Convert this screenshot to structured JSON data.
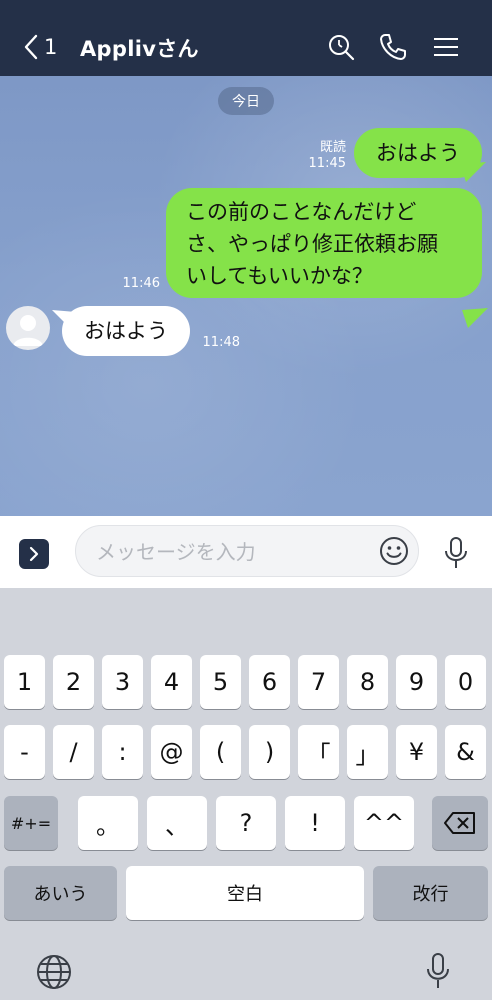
{
  "header": {
    "back_count": "1",
    "title": "Applivさん",
    "icons": [
      "chevron-left-icon",
      "search-icon",
      "phone-icon",
      "menu-icon"
    ]
  },
  "chat": {
    "date_label": "今日",
    "messages": [
      {
        "direction": "out",
        "text": "おはよう",
        "read": "既読",
        "time": "11:45"
      },
      {
        "direction": "out",
        "lines": [
          "この前のことなんだけど",
          "さ、やっぱり修正依頼お願",
          "いしてもいいかな？"
        ],
        "time": "11:46"
      },
      {
        "direction": "in",
        "text": "おはよう",
        "time": "11:48"
      }
    ]
  },
  "input": {
    "placeholder": "メッセージを入力",
    "value": ""
  },
  "keyboard": {
    "row1": [
      "1",
      "2",
      "3",
      "4",
      "5",
      "6",
      "7",
      "8",
      "9",
      "0"
    ],
    "row2": [
      "-",
      "/",
      ":",
      "@",
      "(",
      ")",
      "「",
      "」",
      "¥",
      "&"
    ],
    "row3": {
      "mode": "#+=",
      "keys": [
        "。",
        "、",
        "?",
        "!",
        "^^"
      ]
    },
    "row4": {
      "left": "あいう",
      "space": "空白",
      "return": "改行"
    }
  },
  "colors": {
    "header_bg": "#243048",
    "chat_bg": "#86a0cc",
    "bubble_out": "#85e249",
    "bubble_in": "#ffffff"
  }
}
